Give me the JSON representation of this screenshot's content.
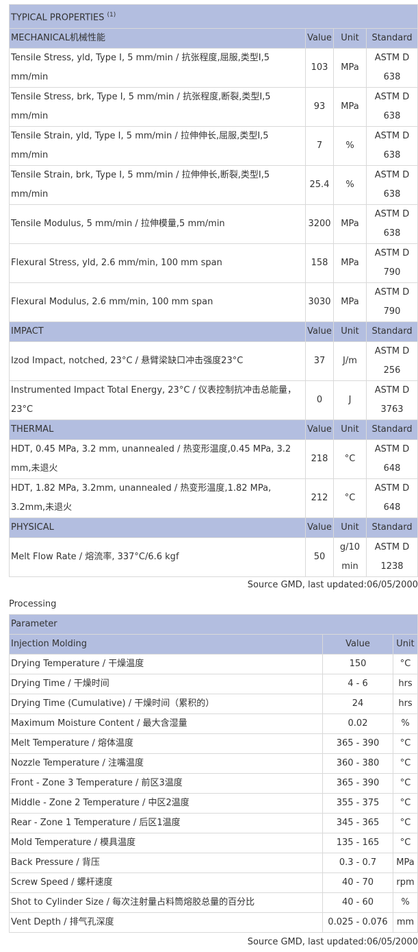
{
  "properties": {
    "title": "TYPICAL PROPERTIES",
    "title_note": "(1)",
    "sections": [
      {
        "name": "MECHANICAL机械性能",
        "col_value": "Value",
        "col_unit": "Unit",
        "col_standard": "Standard",
        "rows": [
          {
            "prop": "Tensile Stress, yld, Type I, 5 mm/min / 抗张程度,屈服,类型I,5 mm/min",
            "value": "103",
            "unit": "MPa",
            "standard": "ASTM D 638"
          },
          {
            "prop": "Tensile Stress, brk, Type I, 5 mm/min / 抗张程度,断裂,类型I,5 mm/min",
            "value": "93",
            "unit": "MPa",
            "standard": "ASTM D 638"
          },
          {
            "prop": "Tensile Strain, yld, Type I, 5 mm/min / 拉伸伸长,屈服,类型I,5 mm/min",
            "value": "7",
            "unit": "%",
            "standard": "ASTM D 638"
          },
          {
            "prop": "Tensile Strain, brk, Type I, 5 mm/min / 拉伸伸长,断裂,类型I,5 mm/min",
            "value": "25.4",
            "unit": "%",
            "standard": "ASTM D 638"
          },
          {
            "prop": "Tensile Modulus, 5 mm/min / 拉伸模量,5 mm/min",
            "value": "3200",
            "unit": "MPa",
            "standard": "ASTM D 638"
          },
          {
            "prop": "Flexural Stress, yld, 2.6 mm/min, 100 mm span",
            "value": "158",
            "unit": "MPa",
            "standard": "ASTM D 790"
          },
          {
            "prop": "Flexural Modulus, 2.6 mm/min, 100 mm span",
            "value": "3030",
            "unit": "MPa",
            "standard": "ASTM D 790"
          }
        ]
      },
      {
        "name": "IMPACT",
        "col_value": "Value",
        "col_unit": "Unit",
        "col_standard": "Standard",
        "rows": [
          {
            "prop": "Izod Impact, notched, 23°C / 悬臂梁缺口冲击强度23°C",
            "value": "37",
            "unit": "J/m",
            "standard": "ASTM D 256"
          },
          {
            "prop": "Instrumented Impact Total Energy, 23°C / 仪表控制抗冲击总能量，23°C",
            "value": "0",
            "unit": "J",
            "standard": "ASTM D 3763"
          }
        ]
      },
      {
        "name": "THERMAL",
        "col_value": "Value",
        "col_unit": "Unit",
        "col_standard": "Standard",
        "rows": [
          {
            "prop": "HDT, 0.45 MPa, 3.2 mm, unannealed / 热变形温度,0.45 MPa, 3.2 mm,未退火",
            "value": "218",
            "unit": "°C",
            "standard": "ASTM D 648"
          },
          {
            "prop": "HDT, 1.82 MPa, 3.2mm, unannealed / 热变形温度,1.82 MPa, 3.2mm,未退火",
            "value": "212",
            "unit": "°C",
            "standard": "ASTM D 648"
          }
        ]
      },
      {
        "name": "PHYSICAL",
        "col_value": "Value",
        "col_unit": "Unit",
        "col_standard": "Standard",
        "rows": [
          {
            "prop": "Melt Flow Rate / 熔流率, 337°C/6.6 kgf",
            "value": "50",
            "unit": "g/10 min",
            "standard": "ASTM D 1238"
          }
        ]
      }
    ],
    "source": "Source GMD, last updated:06/05/2000"
  },
  "processing": {
    "heading": "Processing",
    "param_label": "Parameter",
    "section_name": "Injection Molding",
    "col_value": "Value",
    "col_unit": "Unit",
    "rows": [
      {
        "param": "Drying Temperature / 干燥温度",
        "value": "150",
        "unit": "°C"
      },
      {
        "param": "Drying Time / 干燥时间",
        "value": "4 - 6",
        "unit": "hrs"
      },
      {
        "param": "Drying Time (Cumulative) / 干燥时间（累积的）",
        "value": "24",
        "unit": "hrs"
      },
      {
        "param": "Maximum Moisture Content / 最大含湿量",
        "value": "0.02",
        "unit": "%"
      },
      {
        "param": "Melt Temperature / 熔体温度",
        "value": "365 - 390",
        "unit": "°C"
      },
      {
        "param": "Nozzle Temperature / 注嘴温度",
        "value": "360 - 380",
        "unit": "°C"
      },
      {
        "param": "Front - Zone 3 Temperature / 前区3温度",
        "value": "365 - 390",
        "unit": "°C"
      },
      {
        "param": "Middle - Zone 2 Temperature / 中区2温度",
        "value": "355 - 375",
        "unit": "°C"
      },
      {
        "param": "Rear - Zone 1 Temperature / 后区1温度",
        "value": "345 - 365",
        "unit": "°C"
      },
      {
        "param": "Mold Temperature / 模具温度",
        "value": "135 - 165",
        "unit": "°C"
      },
      {
        "param": "Back Pressure / 背压",
        "value": "0.3 - 0.7",
        "unit": "MPa"
      },
      {
        "param": "Screw Speed / 螺杆速度",
        "value": "40 - 70",
        "unit": "rpm"
      },
      {
        "param": "Shot to Cylinder Size / 每次注射量占料筒熔胶总量的百分比",
        "value": "40 - 60",
        "unit": "%"
      },
      {
        "param": "Vent Depth / 排气孔深度",
        "value": "0.025 - 0.076",
        "unit": "mm"
      }
    ],
    "source": "Source GMD, last updated:06/05/2000"
  }
}
